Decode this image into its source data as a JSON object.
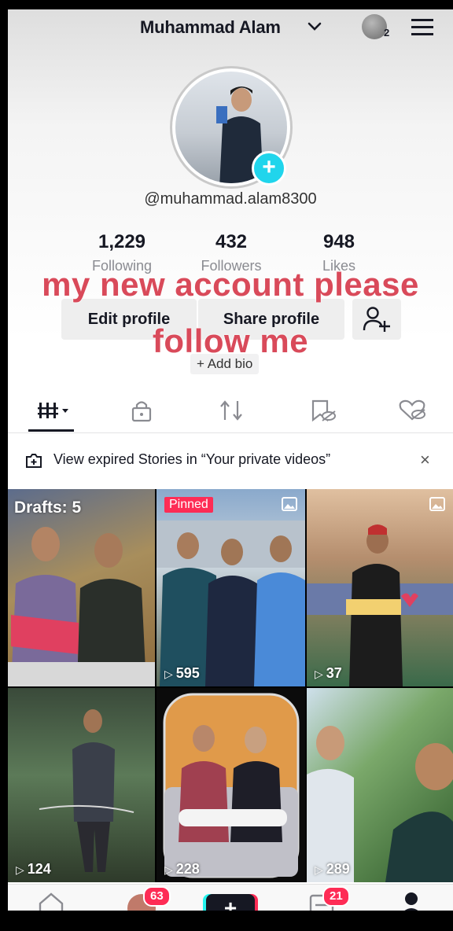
{
  "header": {
    "name": "Muhammad Alam",
    "notif_count": "2"
  },
  "profile": {
    "username": "@muhammad.alam8300"
  },
  "stats": [
    {
      "value": "1,229",
      "label": "Following"
    },
    {
      "value": "432",
      "label": "Followers"
    },
    {
      "value": "948",
      "label": "Likes"
    }
  ],
  "buttons": {
    "edit": "Edit profile",
    "share": "Share profile",
    "add_bio": "+ Add bio"
  },
  "overlay": {
    "line1": "my new account please",
    "line2": "follow me"
  },
  "notice": {
    "text": "View expired Stories in “Your private videos”",
    "close": "×"
  },
  "grid": {
    "drafts_label": "Drafts: 5",
    "pinned_label": "Pinned",
    "views": [
      "595",
      "37",
      "124",
      "228",
      "289"
    ]
  },
  "nav": {
    "inbox_badge": "63",
    "messages_badge": "21",
    "create": "+"
  },
  "colors": {
    "accent": "#fe2c55",
    "cyan": "#20d5ec",
    "overlay_text": "#d94a5a"
  }
}
